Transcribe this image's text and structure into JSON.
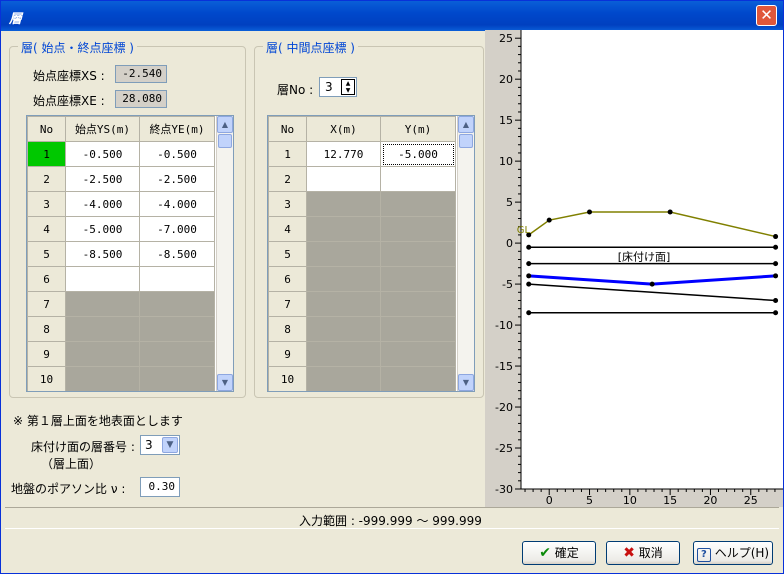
{
  "window": {
    "title": "層",
    "close": "✕"
  },
  "endpoints": {
    "title": "層( 始点・終点座標 )",
    "xs_label": "始点座標XS :",
    "xs_value": "-2.540",
    "xe_label": "始点座標XE :",
    "xe_value": "28.080",
    "headers": [
      "No",
      "始点YS(m)",
      "終点YE(m)"
    ],
    "rows": [
      {
        "no": "1",
        "ys": "-0.500",
        "ye": "-0.500"
      },
      {
        "no": "2",
        "ys": "-2.500",
        "ye": "-2.500"
      },
      {
        "no": "3",
        "ys": "-4.000",
        "ye": "-4.000"
      },
      {
        "no": "4",
        "ys": "-5.000",
        "ye": "-7.000"
      },
      {
        "no": "5",
        "ys": "-8.500",
        "ye": "-8.500"
      },
      {
        "no": "6",
        "ys": "",
        "ye": ""
      },
      {
        "no": "7",
        "ys": "",
        "ye": ""
      },
      {
        "no": "8",
        "ys": "",
        "ye": ""
      },
      {
        "no": "9",
        "ys": "",
        "ye": ""
      },
      {
        "no": "10",
        "ys": "",
        "ye": ""
      }
    ]
  },
  "midpoints": {
    "title": "層( 中間点座標 )",
    "layer_no_label": "層No :",
    "layer_no_value": "3",
    "headers": [
      "No",
      "X(m)",
      "Y(m)"
    ],
    "rows": [
      {
        "no": "1",
        "x": "12.770",
        "y": "-5.000"
      },
      {
        "no": "2",
        "x": "",
        "y": ""
      },
      {
        "no": "3",
        "x": "",
        "y": ""
      },
      {
        "no": "4",
        "x": "",
        "y": ""
      },
      {
        "no": "5",
        "x": "",
        "y": ""
      },
      {
        "no": "6",
        "x": "",
        "y": ""
      },
      {
        "no": "7",
        "x": "",
        "y": ""
      },
      {
        "no": "8",
        "x": "",
        "y": ""
      },
      {
        "no": "9",
        "x": "",
        "y": ""
      },
      {
        "no": "10",
        "x": "",
        "y": ""
      }
    ]
  },
  "note": "※ 第１層上面を地表面とします",
  "floor_layer": {
    "label": "床付け面の層番号 :",
    "sub_label": "（層上面）",
    "value": "3"
  },
  "poisson": {
    "label": "地盤のポアソン比 ν :",
    "value": "0.30"
  },
  "status": {
    "range": "入力範囲 : -999.999 ～ 999.999"
  },
  "buttons": {
    "ok": "確定",
    "cancel": "取消",
    "help": "ヘルプ(H)"
  },
  "chart": {
    "y_ticks": [
      "25",
      "20",
      "15",
      "10",
      "5",
      "0",
      "-5",
      "-10",
      "-15",
      "-20",
      "-25",
      "-30"
    ],
    "x_ticks": [
      "0",
      "5",
      "10",
      "15",
      "20",
      "25"
    ],
    "gl_label": "GL",
    "floor_label": "[床付け面]"
  },
  "chart_data": {
    "type": "line",
    "xlim": [
      -3.5,
      29
    ],
    "ylim": [
      -30,
      26
    ],
    "series": [
      {
        "color": "#808000",
        "points": [
          [
            -2.54,
            1.0
          ],
          [
            0,
            2.8
          ],
          [
            5,
            3.8
          ],
          [
            15,
            3.8
          ],
          [
            28.08,
            0.8
          ]
        ]
      },
      {
        "color": "#000000",
        "points": [
          [
            -2.54,
            -0.5
          ],
          [
            28.08,
            -0.5
          ]
        ]
      },
      {
        "color": "#000000",
        "points": [
          [
            -2.54,
            -2.5
          ],
          [
            28.08,
            -2.5
          ]
        ]
      },
      {
        "color": "#0000ff",
        "points": [
          [
            -2.54,
            -4.0
          ],
          [
            12.77,
            -5.0
          ],
          [
            28.08,
            -4.0
          ]
        ]
      },
      {
        "color": "#000000",
        "points": [
          [
            -2.54,
            -5.0
          ],
          [
            28.08,
            -7.0
          ]
        ]
      },
      {
        "color": "#000000",
        "points": [
          [
            -2.54,
            -8.5
          ],
          [
            28.08,
            -8.5
          ]
        ]
      }
    ]
  }
}
